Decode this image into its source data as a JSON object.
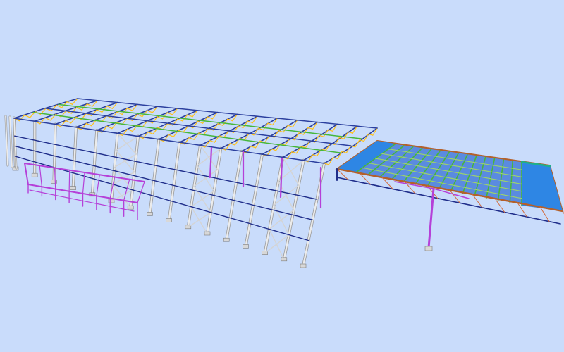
{
  "scene": {
    "subject": "steel-frame-structure-3d-model",
    "background_color": "#c9dcfb",
    "member_colors": {
      "column": "#ebebeb",
      "column_outline": "#9a9a9a",
      "brace": "#d4d4d4",
      "truss_chord": "#2b3f9e",
      "truss_web": "#ffc21a",
      "purlin_green": "#46b63c",
      "tie_beam": "#1f2d8a",
      "platform_magenta": "#b540d8",
      "roof_sheeting": "#2e86e4",
      "canopy_edge": "#b4602a",
      "roof_edge_teal": "#1fb08a"
    }
  }
}
